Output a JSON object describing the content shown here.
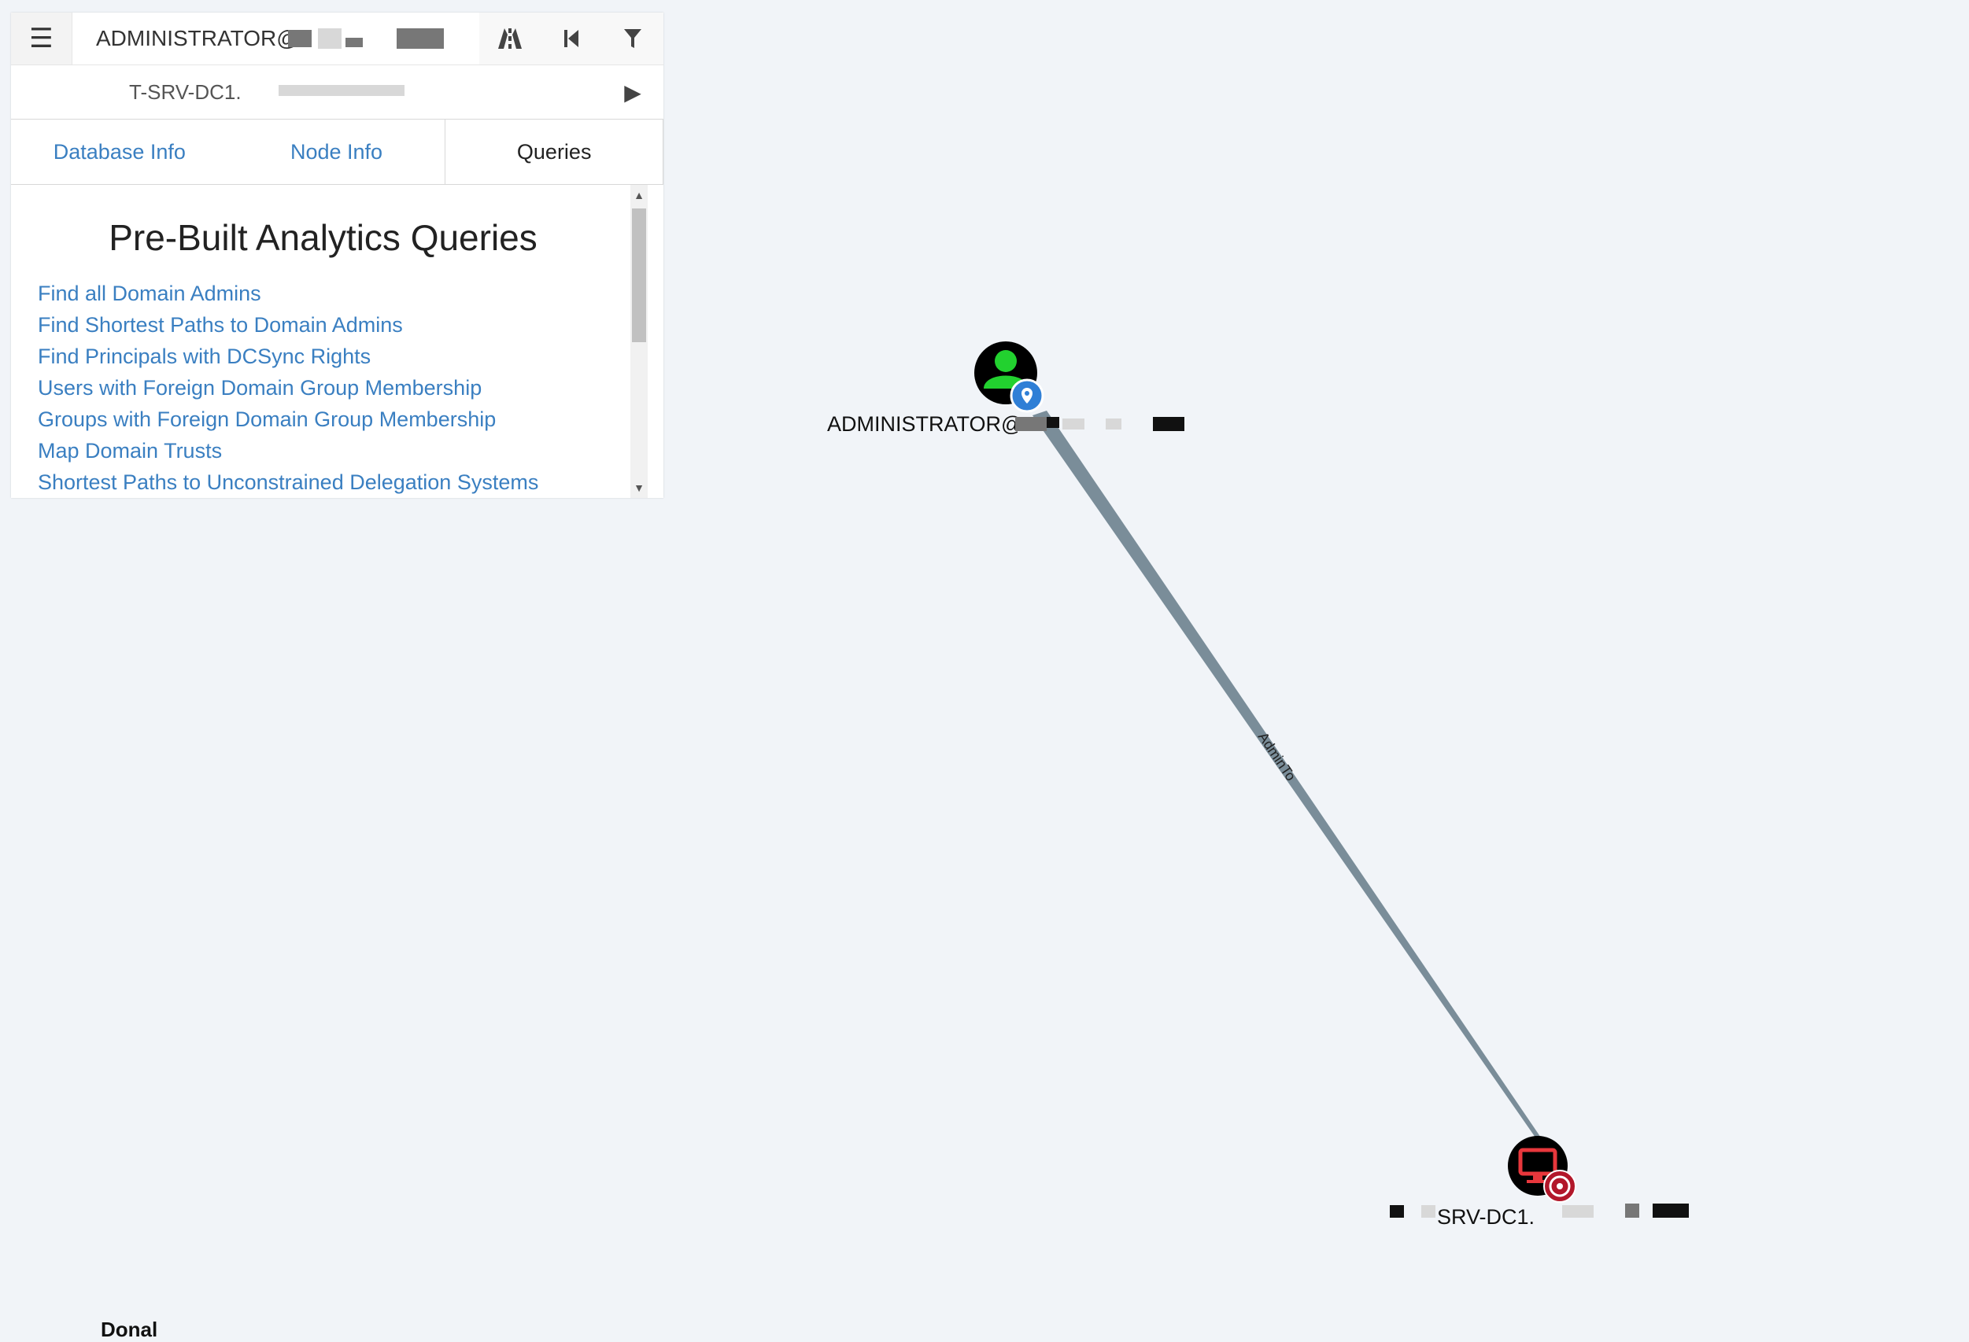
{
  "search": {
    "menu_icon": "hamburger-menu-icon",
    "start_value": "ADMINISTRATOR@",
    "target_value": "T-SRV-DC1.",
    "tools": [
      "pathfinding-icon",
      "back-icon",
      "filter-icon"
    ],
    "play_icon": "play-icon"
  },
  "tabs": [
    {
      "label": "Database Info"
    },
    {
      "label": "Node Info"
    },
    {
      "label": "Queries"
    }
  ],
  "active_tab": "Queries",
  "queries": {
    "title": "Pre-Built Analytics Queries",
    "items": [
      "Find all Domain Admins",
      "Find Shortest Paths to Domain Admins",
      "Find Principals with DCSync Rights",
      "Users with Foreign Domain Group Membership",
      "Groups with Foreign Domain Group Membership",
      "Map Domain Trusts",
      "Shortest Paths to Unconstrained Delegation Systems"
    ]
  },
  "graph": {
    "nodes": [
      {
        "id": "user",
        "type": "User",
        "label": "ADMINISTRATOR@",
        "icon": "user-icon",
        "badge": "start-node-pin-icon",
        "color": "#22d12f"
      },
      {
        "id": "computer",
        "type": "Computer",
        "label": "SRV-DC1.",
        "icon": "computer-icon",
        "badge": "target-node-icon",
        "color": "#e8373c"
      }
    ],
    "edges": [
      {
        "from": "user",
        "to": "computer",
        "label": "AdminTo"
      }
    ],
    "edge_color": "#7a8d99"
  },
  "bottom_label": "Donal"
}
